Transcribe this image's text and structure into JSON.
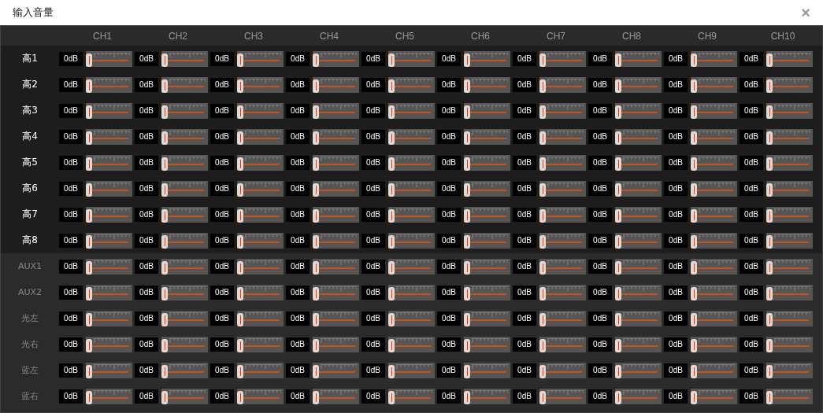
{
  "window": {
    "title": "输入音量",
    "close": "×"
  },
  "columns": [
    "CH1",
    "CH2",
    "CH3",
    "CH4",
    "CH5",
    "CH6",
    "CH7",
    "CH8",
    "CH9",
    "CH10"
  ],
  "rows": [
    {
      "label": "高1",
      "disabled": false,
      "cells": [
        {
          "reading": "0dB",
          "level": 0
        },
        {
          "reading": "0dB",
          "level": 0
        },
        {
          "reading": "0dB",
          "level": 0
        },
        {
          "reading": "0dB",
          "level": 0
        },
        {
          "reading": "0dB",
          "level": 0
        },
        {
          "reading": "0dB",
          "level": 0
        },
        {
          "reading": "0dB",
          "level": 0
        },
        {
          "reading": "0dB",
          "level": 0
        },
        {
          "reading": "0dB",
          "level": 0
        },
        {
          "reading": "0dB",
          "level": 0
        }
      ]
    },
    {
      "label": "高2",
      "disabled": false,
      "cells": [
        {
          "reading": "0dB",
          "level": 0
        },
        {
          "reading": "0dB",
          "level": 0
        },
        {
          "reading": "0dB",
          "level": 0
        },
        {
          "reading": "0dB",
          "level": 0
        },
        {
          "reading": "0dB",
          "level": 0
        },
        {
          "reading": "0dB",
          "level": 0
        },
        {
          "reading": "0dB",
          "level": 0
        },
        {
          "reading": "0dB",
          "level": 0
        },
        {
          "reading": "0dB",
          "level": 0
        },
        {
          "reading": "0dB",
          "level": 0
        }
      ]
    },
    {
      "label": "高3",
      "disabled": false,
      "cells": [
        {
          "reading": "0dB",
          "level": 0
        },
        {
          "reading": "0dB",
          "level": 0
        },
        {
          "reading": "0dB",
          "level": 0
        },
        {
          "reading": "0dB",
          "level": 0
        },
        {
          "reading": "0dB",
          "level": 0
        },
        {
          "reading": "0dB",
          "level": 0
        },
        {
          "reading": "0dB",
          "level": 0
        },
        {
          "reading": "0dB",
          "level": 0
        },
        {
          "reading": "0dB",
          "level": 0
        },
        {
          "reading": "0dB",
          "level": 0
        }
      ]
    },
    {
      "label": "高4",
      "disabled": false,
      "cells": [
        {
          "reading": "0dB",
          "level": 0
        },
        {
          "reading": "0dB",
          "level": 0
        },
        {
          "reading": "0dB",
          "level": 0
        },
        {
          "reading": "0dB",
          "level": 0
        },
        {
          "reading": "0dB",
          "level": 0
        },
        {
          "reading": "0dB",
          "level": 0
        },
        {
          "reading": "0dB",
          "level": 0
        },
        {
          "reading": "0dB",
          "level": 0
        },
        {
          "reading": "0dB",
          "level": 0
        },
        {
          "reading": "0dB",
          "level": 0
        }
      ]
    },
    {
      "label": "高5",
      "disabled": false,
      "cells": [
        {
          "reading": "0dB",
          "level": 0
        },
        {
          "reading": "0dB",
          "level": 0
        },
        {
          "reading": "0dB",
          "level": 0
        },
        {
          "reading": "0dB",
          "level": 0
        },
        {
          "reading": "0dB",
          "level": 0
        },
        {
          "reading": "0dB",
          "level": 0
        },
        {
          "reading": "0dB",
          "level": 0
        },
        {
          "reading": "0dB",
          "level": 0
        },
        {
          "reading": "0dB",
          "level": 0
        },
        {
          "reading": "0dB",
          "level": 0
        }
      ]
    },
    {
      "label": "高6",
      "disabled": false,
      "cells": [
        {
          "reading": "0dB",
          "level": 0
        },
        {
          "reading": "0dB",
          "level": 0
        },
        {
          "reading": "0dB",
          "level": 0
        },
        {
          "reading": "0dB",
          "level": 0
        },
        {
          "reading": "0dB",
          "level": 0
        },
        {
          "reading": "0dB",
          "level": 0
        },
        {
          "reading": "0dB",
          "level": 0
        },
        {
          "reading": "0dB",
          "level": 0
        },
        {
          "reading": "0dB",
          "level": 0
        },
        {
          "reading": "0dB",
          "level": 0
        }
      ]
    },
    {
      "label": "高7",
      "disabled": false,
      "cells": [
        {
          "reading": "0dB",
          "level": 0
        },
        {
          "reading": "0dB",
          "level": 0
        },
        {
          "reading": "0dB",
          "level": 0
        },
        {
          "reading": "0dB",
          "level": 0
        },
        {
          "reading": "0dB",
          "level": 0
        },
        {
          "reading": "0dB",
          "level": 0
        },
        {
          "reading": "0dB",
          "level": 0
        },
        {
          "reading": "0dB",
          "level": 0
        },
        {
          "reading": "0dB",
          "level": 0
        },
        {
          "reading": "0dB",
          "level": 0
        }
      ]
    },
    {
      "label": "高8",
      "disabled": false,
      "cells": [
        {
          "reading": "0dB",
          "level": 0
        },
        {
          "reading": "0dB",
          "level": 0
        },
        {
          "reading": "0dB",
          "level": 0
        },
        {
          "reading": "0dB",
          "level": 0
        },
        {
          "reading": "0dB",
          "level": 0
        },
        {
          "reading": "0dB",
          "level": 0
        },
        {
          "reading": "0dB",
          "level": 0
        },
        {
          "reading": "0dB",
          "level": 0
        },
        {
          "reading": "0dB",
          "level": 0
        },
        {
          "reading": "0dB",
          "level": 0
        }
      ]
    },
    {
      "label": "AUX1",
      "disabled": true,
      "cells": [
        {
          "reading": "0dB",
          "level": 0
        },
        {
          "reading": "0dB",
          "level": 0
        },
        {
          "reading": "0dB",
          "level": 0
        },
        {
          "reading": "0dB",
          "level": 0
        },
        {
          "reading": "0dB",
          "level": 0
        },
        {
          "reading": "0dB",
          "level": 0
        },
        {
          "reading": "0dB",
          "level": 0
        },
        {
          "reading": "0dB",
          "level": 0
        },
        {
          "reading": "0dB",
          "level": 0
        },
        {
          "reading": "0dB",
          "level": 0
        }
      ]
    },
    {
      "label": "AUX2",
      "disabled": true,
      "cells": [
        {
          "reading": "0dB",
          "level": 0
        },
        {
          "reading": "0dB",
          "level": 0
        },
        {
          "reading": "0dB",
          "level": 0
        },
        {
          "reading": "0dB",
          "level": 0
        },
        {
          "reading": "0dB",
          "level": 0
        },
        {
          "reading": "0dB",
          "level": 0
        },
        {
          "reading": "0dB",
          "level": 0
        },
        {
          "reading": "0dB",
          "level": 0
        },
        {
          "reading": "0dB",
          "level": 0
        },
        {
          "reading": "0dB",
          "level": 0
        }
      ]
    },
    {
      "label": "光左",
      "disabled": true,
      "cells": [
        {
          "reading": "0dB",
          "level": 0
        },
        {
          "reading": "0dB",
          "level": 0
        },
        {
          "reading": "0dB",
          "level": 0
        },
        {
          "reading": "0dB",
          "level": 0
        },
        {
          "reading": "0dB",
          "level": 0
        },
        {
          "reading": "0dB",
          "level": 0
        },
        {
          "reading": "0dB",
          "level": 0
        },
        {
          "reading": "0dB",
          "level": 0
        },
        {
          "reading": "0dB",
          "level": 0
        },
        {
          "reading": "0dB",
          "level": 0
        }
      ]
    },
    {
      "label": "光右",
      "disabled": true,
      "cells": [
        {
          "reading": "0dB",
          "level": 0
        },
        {
          "reading": "0dB",
          "level": 0
        },
        {
          "reading": "0dB",
          "level": 0
        },
        {
          "reading": "0dB",
          "level": 0
        },
        {
          "reading": "0dB",
          "level": 0
        },
        {
          "reading": "0dB",
          "level": 0
        },
        {
          "reading": "0dB",
          "level": 0
        },
        {
          "reading": "0dB",
          "level": 0
        },
        {
          "reading": "0dB",
          "level": 0
        },
        {
          "reading": "0dB",
          "level": 0
        }
      ]
    },
    {
      "label": "蓝左",
      "disabled": true,
      "cells": [
        {
          "reading": "0dB",
          "level": 0
        },
        {
          "reading": "0dB",
          "level": 0
        },
        {
          "reading": "0dB",
          "level": 0
        },
        {
          "reading": "0dB",
          "level": 0
        },
        {
          "reading": "0dB",
          "level": 0
        },
        {
          "reading": "0dB",
          "level": 0
        },
        {
          "reading": "0dB",
          "level": 0
        },
        {
          "reading": "0dB",
          "level": 0
        },
        {
          "reading": "0dB",
          "level": 0
        },
        {
          "reading": "0dB",
          "level": 0
        }
      ]
    },
    {
      "label": "蓝右",
      "disabled": true,
      "cells": [
        {
          "reading": "0dB",
          "level": 0
        },
        {
          "reading": "0dB",
          "level": 0
        },
        {
          "reading": "0dB",
          "level": 0
        },
        {
          "reading": "0dB",
          "level": 0
        },
        {
          "reading": "0dB",
          "level": 0
        },
        {
          "reading": "0dB",
          "level": 0
        },
        {
          "reading": "0dB",
          "level": 0
        },
        {
          "reading": "0dB",
          "level": 0
        },
        {
          "reading": "0dB",
          "level": 0
        },
        {
          "reading": "0dB",
          "level": 0
        }
      ]
    }
  ]
}
